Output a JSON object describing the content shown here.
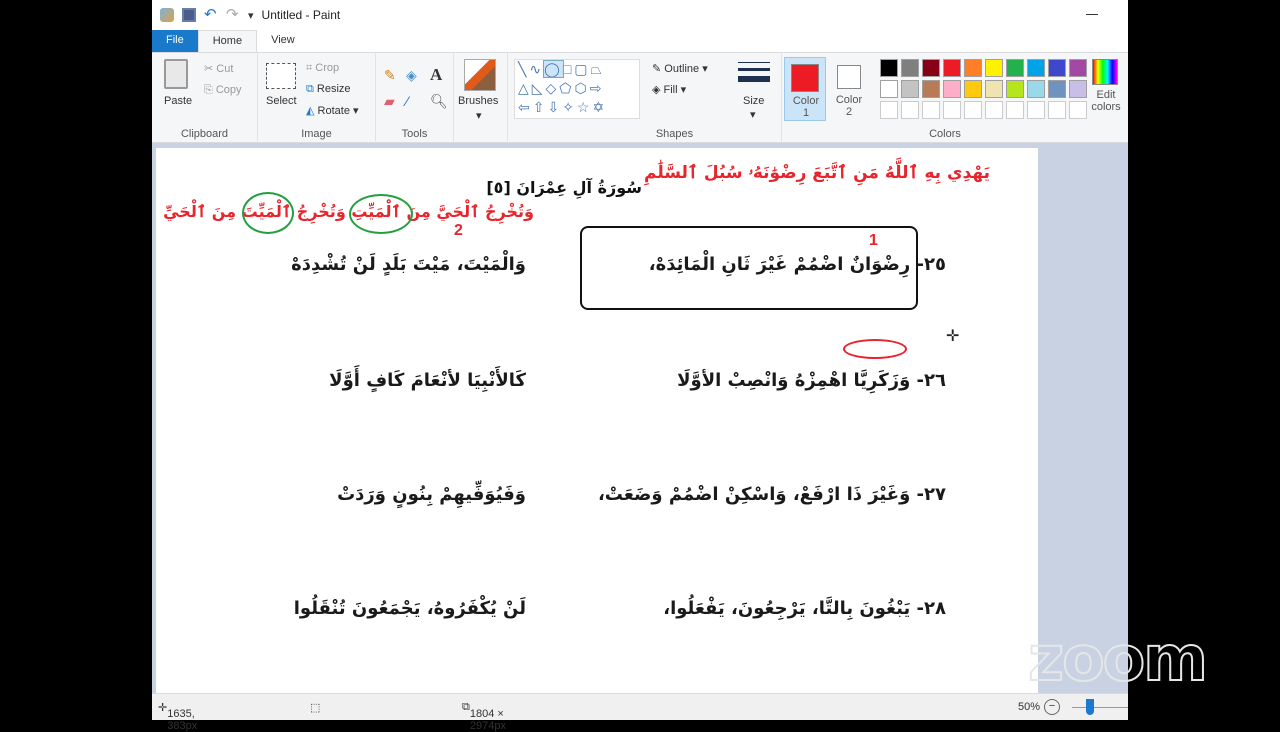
{
  "window": {
    "title": "Untitled - Paint"
  },
  "tabs": [
    {
      "label": "File"
    },
    {
      "label": "Home"
    },
    {
      "label": "View"
    }
  ],
  "ribbon": {
    "clipboard": {
      "label": "Clipboard",
      "paste": "Paste",
      "cut": "Cut",
      "copy": "Copy"
    },
    "image": {
      "label": "Image",
      "select": "Select",
      "crop": "Crop",
      "resize": "Resize",
      "rotate": "Rotate"
    },
    "tools": {
      "label": "Tools"
    },
    "brushes": {
      "label": "Brushes"
    },
    "shapes": {
      "label": "Shapes",
      "outline": "Outline",
      "fill": "Fill",
      "selected_shape": "oval"
    },
    "size": {
      "label": "Size"
    },
    "colors": {
      "label": "Colors",
      "color1": "Color",
      "color1_num": "1",
      "color2": "Color",
      "color2_num": "2",
      "color1_value": "#ed1c24",
      "color2_value": "#ffffff",
      "edit": "Edit",
      "edit2": "colors",
      "palette": [
        "#000000",
        "#7f7f7f",
        "#880015",
        "#ed1c24",
        "#ff7f27",
        "#fff200",
        "#22b14c",
        "#00a2e8",
        "#3f48cc",
        "#a349a4",
        "#ffffff",
        "#c3c3c3",
        "#b97a57",
        "#ffaec9",
        "#ffc90e",
        "#efe4b0",
        "#b5e61d",
        "#99d9ea",
        "#7092be",
        "#c8bfe7"
      ]
    }
  },
  "canvas": {
    "header_red": "يَهْدِي بِهِ ٱللَّهُ مَنِ ٱتَّبَعَ رِضْوَٰنَهُۥ سُبُلَ ٱلسَّلَٰمِ",
    "surah": "سُورَةُ آلِ عِمْرَانَ [٥]",
    "verse_red": "وَتُخْرِجُ ٱلْحَيَّ مِنَ ٱلْمَيِّتِ وَتُخْرِجُ ٱلْمَيِّتَ مِنَ ٱلْحَيِّ",
    "mark1": "1",
    "mark2": "2",
    "lines": [
      {
        "right": "٢٥- رِضْوَانٌ اضْمُمْ غَيْرَ ثَانِ الْمَائِدَهْ،",
        "left": "وَالْمَيْتَ، مَيْتَ بَلَدٍ لَنْ تُشْدِدَهْ"
      },
      {
        "right": "٢٦- وَزَكَرِيَّا اهْمِزْهُ وَانْصِبْ الأوَّلَا",
        "left": "كَالأَنْبِيَا لأنْعَامَ كَافٍ أَوَّلَا"
      },
      {
        "right": "٢٧- وَغَيْرَ ذَا ارْفَعْ، وَاسْكِنْ اضْمُمْ وَضَعَتْ،",
        "left": "وَفَيُوَفِّيهِمْ بِنُونٍ وَرَدَتْ"
      },
      {
        "right": "٢٨- يَبْغُونَ بِالتَّا، يَرْجِعُونَ، يَفْعَلُوا،",
        "left": "لَنْ يُكْفَرُوهُ، يَجْمَعُونَ تُنْقَلُوا"
      }
    ]
  },
  "status": {
    "cursor": "1635, 383px",
    "size": "1804 × 2974px",
    "zoom": "50%"
  },
  "overlay": {
    "logo": "zoom"
  }
}
